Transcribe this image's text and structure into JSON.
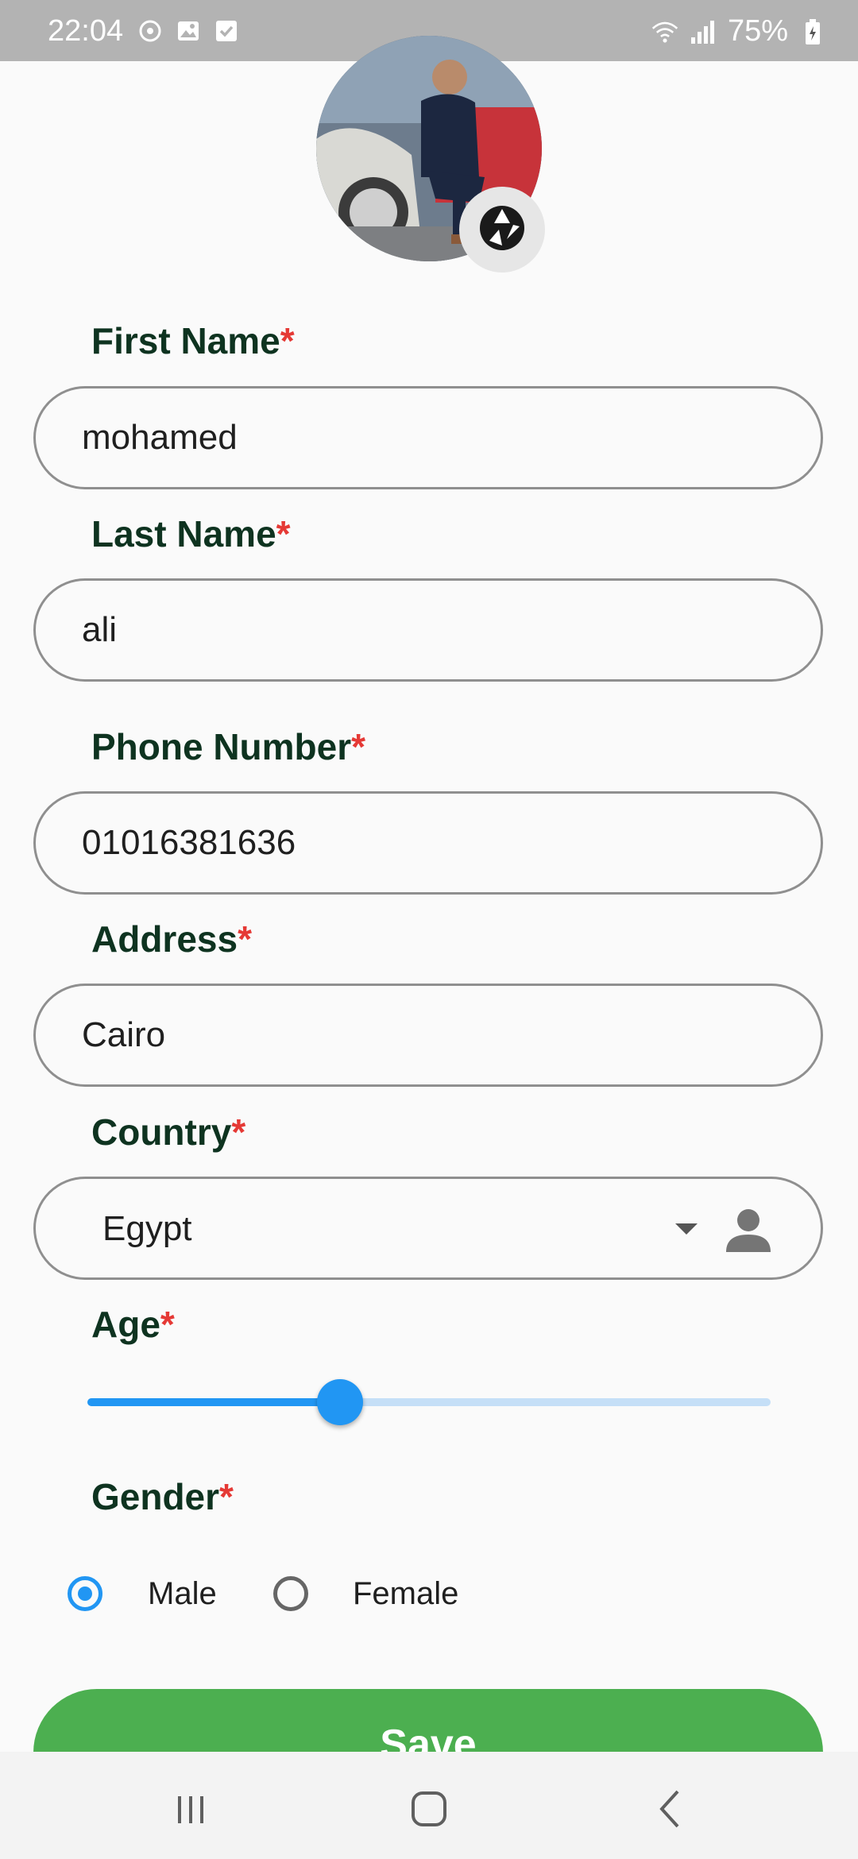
{
  "status_bar": {
    "time": "22:04",
    "battery": "75%",
    "icons_left": [
      "sync-icon",
      "gallery-icon",
      "check-icon"
    ],
    "icons_right": [
      "wifi-icon",
      "signal-icon",
      "battery-icon"
    ]
  },
  "profile": {
    "avatar": "profile-photo",
    "camera_icon": "camera-shutter-icon"
  },
  "form": {
    "required_mark": "*",
    "first_name": {
      "label": "First Name",
      "value": "mohamed"
    },
    "last_name": {
      "label": "Last Name",
      "value": "ali"
    },
    "phone": {
      "label": "Phone Number",
      "value": "01016381636"
    },
    "address": {
      "label": "Address",
      "value": "Cairo"
    },
    "country": {
      "label": "Country",
      "value": "Egypt"
    },
    "age": {
      "label": "Age",
      "level": 0.37
    },
    "gender": {
      "label": "Gender",
      "options": [
        {
          "label": "Male",
          "selected": true
        },
        {
          "label": "Female",
          "selected": false
        }
      ]
    },
    "save_label": "Save"
  },
  "colors": {
    "accent": "#2196f3",
    "label": "#0e3320",
    "required": "#e53935",
    "save": "#4caf50"
  }
}
